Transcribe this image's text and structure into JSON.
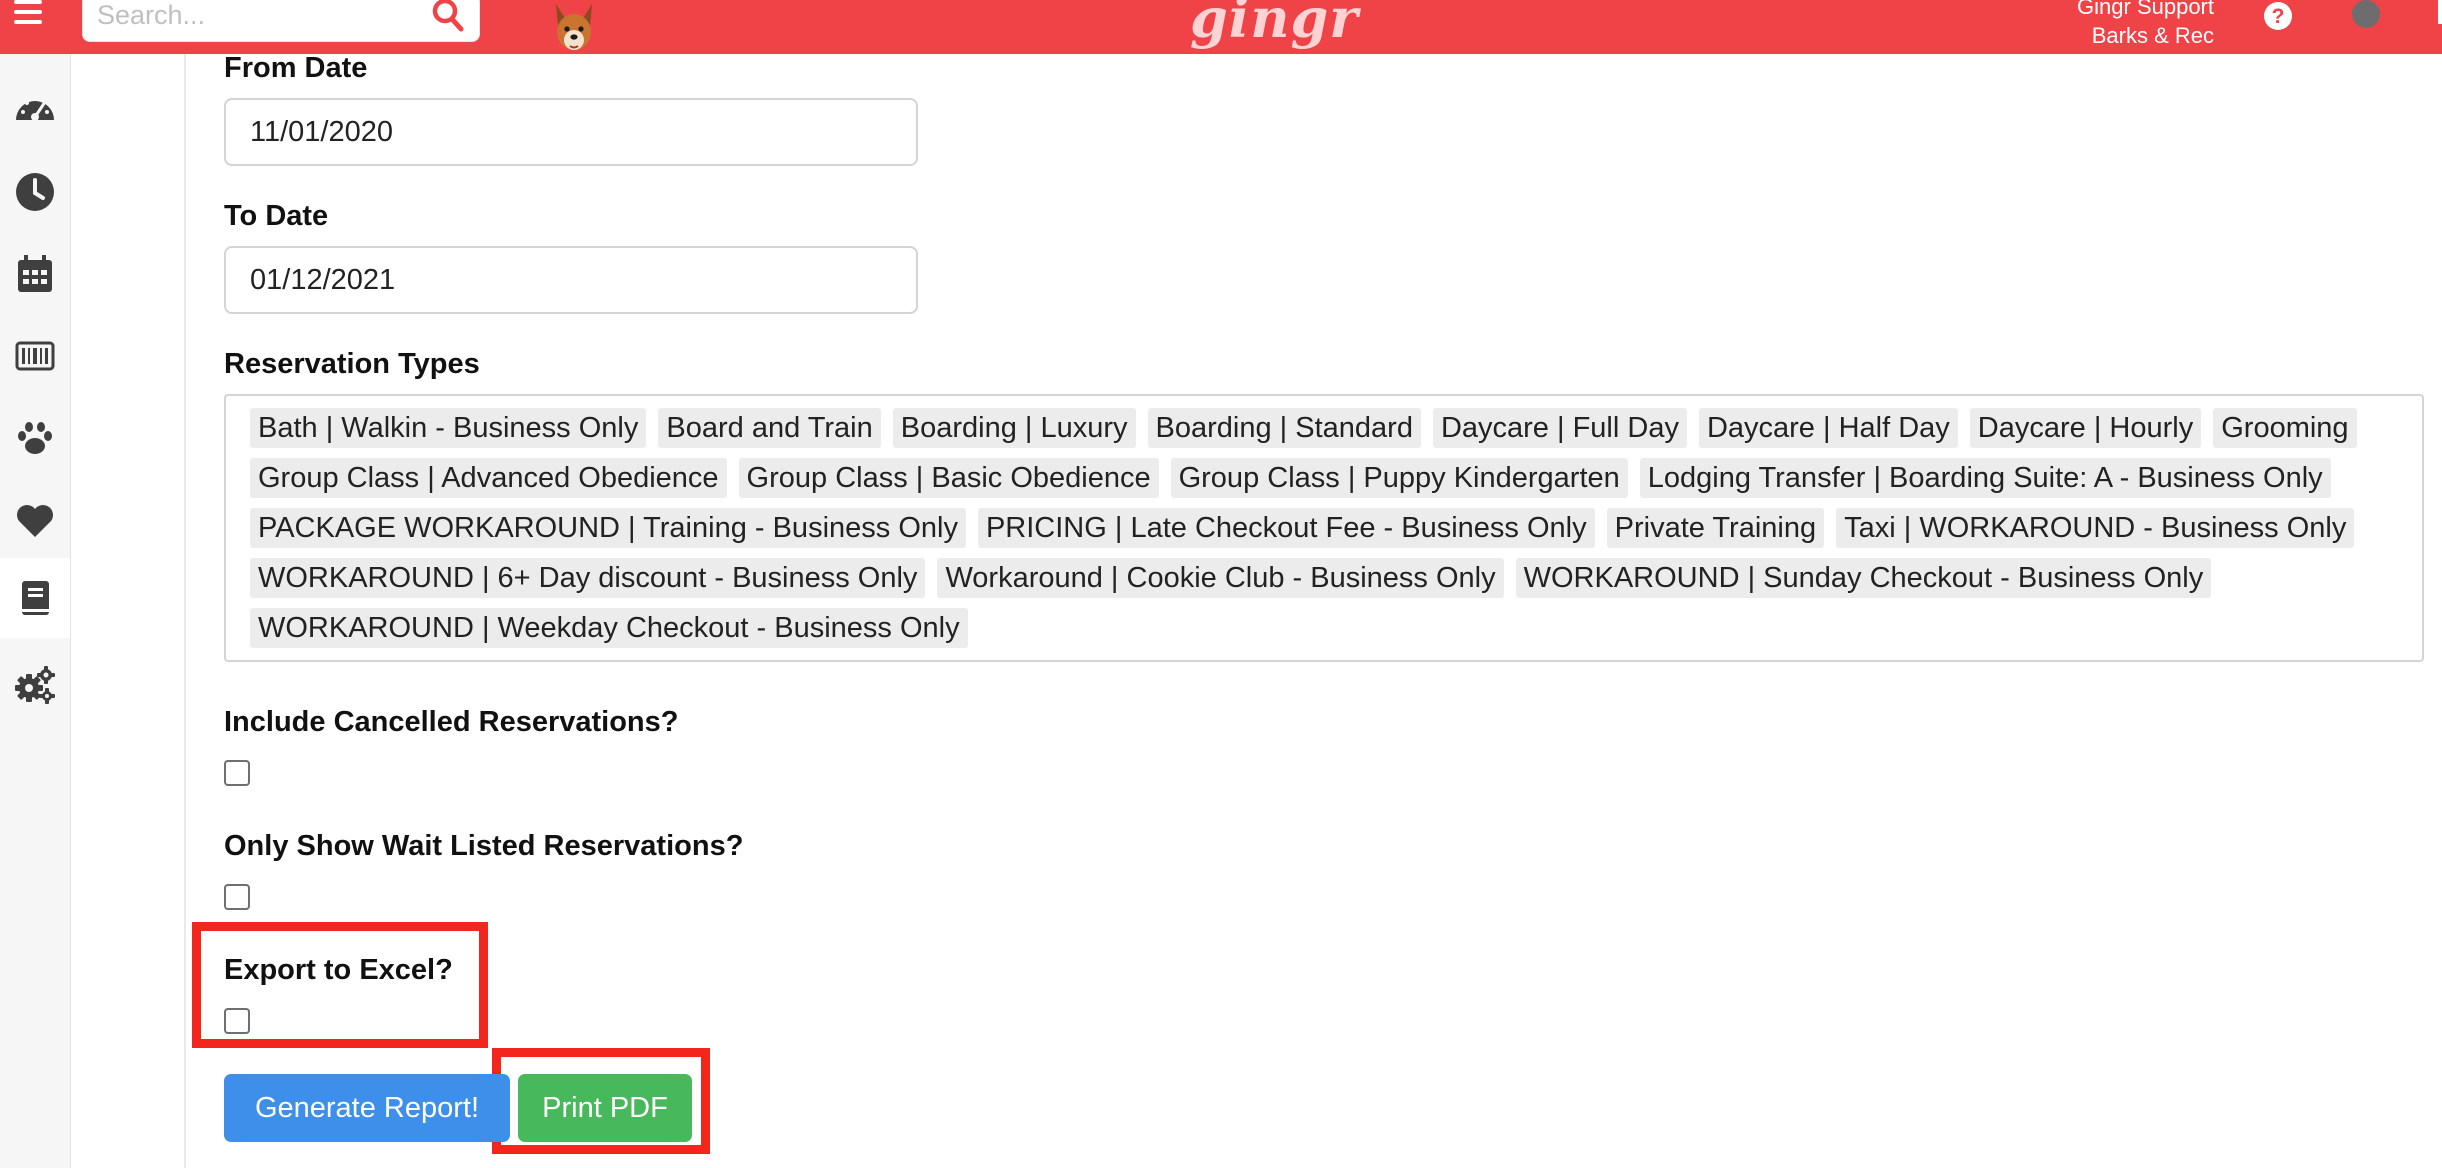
{
  "header": {
    "search_placeholder": "Search...",
    "brand": "gingr",
    "user_name": "Gingr Support",
    "location": "Barks & Rec"
  },
  "sidebar": {
    "items": [
      {
        "icon": "dashboard-icon"
      },
      {
        "icon": "clock-icon"
      },
      {
        "icon": "calendar-icon"
      },
      {
        "icon": "barcode-icon"
      },
      {
        "icon": "paw-icon"
      },
      {
        "icon": "heart-icon"
      },
      {
        "icon": "book-icon",
        "active": true
      },
      {
        "icon": "gears-icon"
      }
    ]
  },
  "form": {
    "from_date_label": "From Date",
    "from_date_value": "11/01/2020",
    "to_date_label": "To Date",
    "to_date_value": "01/12/2021",
    "reservation_types_label": "Reservation Types",
    "reservation_types": [
      [
        "Bath | Walkin - Business Only",
        "Board and Train",
        "Boarding | Luxury",
        "Boarding | Standard",
        "Daycare | Full Day",
        "Daycare | Half Day",
        "Daycare | Hourly",
        "Grooming"
      ],
      [
        "Group Class | Advanced Obedience",
        "Group Class | Basic Obedience",
        "Group Class | Puppy Kindergarten",
        "Lodging Transfer | Boarding Suite: A - Business Only"
      ],
      [
        "PACKAGE WORKAROUND | Training - Business Only",
        "PRICING | Late Checkout Fee - Business Only",
        "Private Training",
        "Taxi | WORKAROUND - Business Only"
      ],
      [
        "WORKAROUND | 6+ Day discount - Business Only",
        "Workaround | Cookie Club - Business Only",
        "WORKAROUND | Sunday Checkout - Business Only"
      ],
      [
        "WORKAROUND | Weekday Checkout - Business Only"
      ]
    ],
    "include_cancelled_label": "Include Cancelled Reservations?",
    "include_cancelled_checked": false,
    "wait_listed_label": "Only Show Wait Listed Reservations?",
    "wait_listed_checked": false,
    "export_excel_label": "Export to Excel?",
    "export_excel_checked": false
  },
  "buttons": {
    "generate": "Generate Report!",
    "print": "Print PDF"
  },
  "colors": {
    "header": "#f04347",
    "highlight": "#f2261c",
    "generate_button": "#3d8fe9",
    "print_button": "#48b85c",
    "sidebar_icon": "#3f3f3f"
  }
}
